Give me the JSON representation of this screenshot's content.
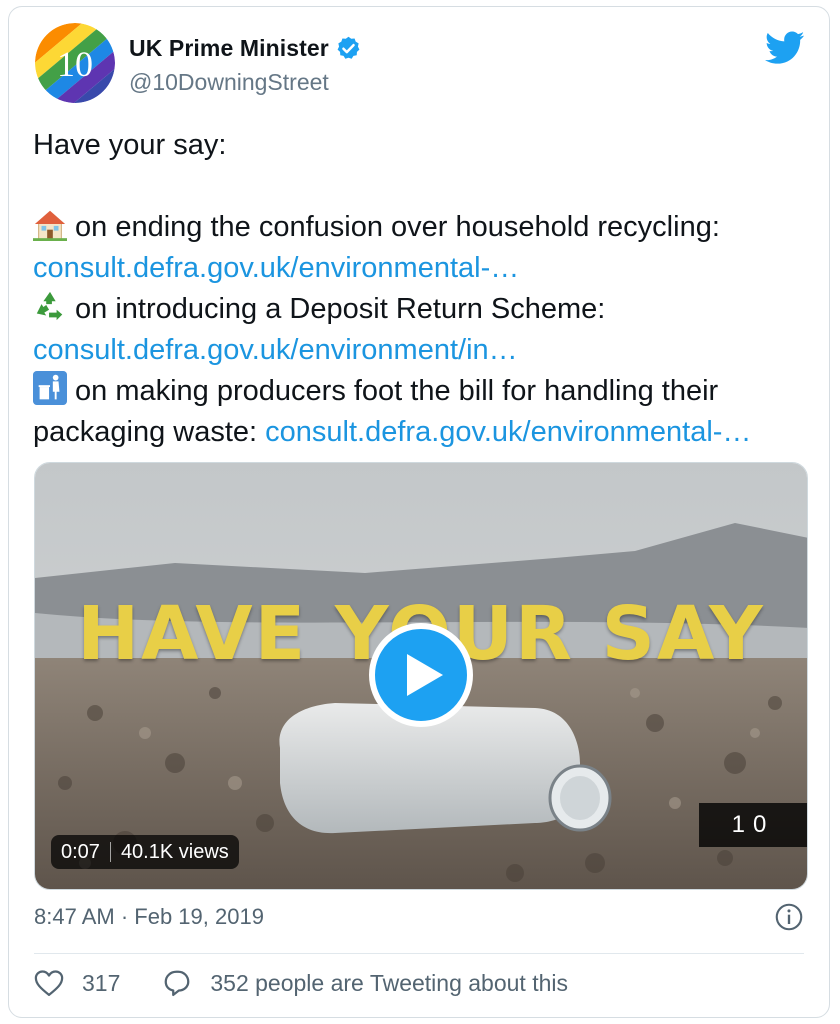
{
  "tweet": {
    "author": {
      "name": "UK Prime Minister",
      "handle": "@10DowningStreet",
      "avatar_text": "10",
      "verified": true
    },
    "text": {
      "intro": "Have your say:",
      "item1_text": "on ending the confusion over household recycling:",
      "item1_link": "consult.defra.gov.uk/environmental-…",
      "item2_text": "on introducing a Deposit Return Scheme:",
      "item2_link": "consult.defra.gov.uk/environment/in…",
      "item3_text": "on making producers foot the bill for handling their",
      "item3_text_cont": "packaging waste:",
      "item3_link": "consult.defra.gov.uk/environmental-…"
    },
    "media": {
      "headline": "HAVE YOUR SAY",
      "duration": "0:07",
      "views": "40.1K views",
      "watermark": "10"
    },
    "timestamp": "8:47 AM · Feb 19, 2019",
    "likes": "317",
    "discussion": "352 people are Tweeting about this"
  },
  "icons": {
    "item1": "house-icon",
    "item2": "recycle-icon",
    "item3": "litter-bin-icon",
    "logo": "twitter-bird-icon"
  },
  "colors": {
    "link": "#1b95e0",
    "verified": "#1da1f2",
    "play_button": "#1da1f2",
    "headline": "#e8cf47"
  }
}
